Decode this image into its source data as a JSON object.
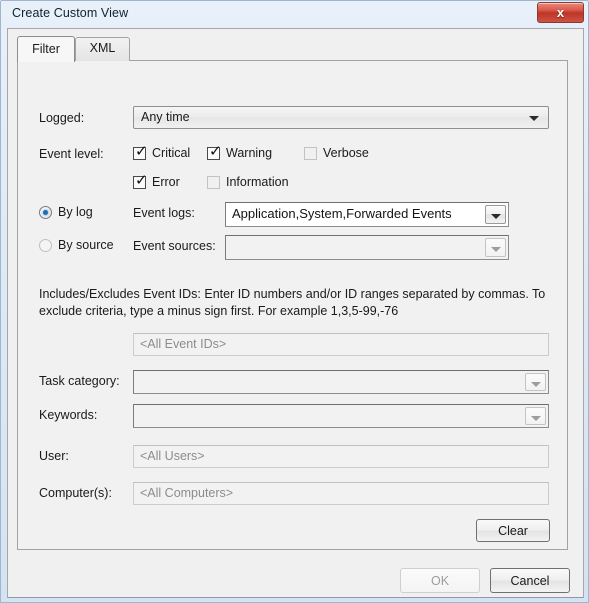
{
  "window": {
    "title": "Create Custom View",
    "close_label": "x"
  },
  "tabs": [
    {
      "label": "Filter",
      "active": true
    },
    {
      "label": "XML",
      "active": false
    }
  ],
  "filter": {
    "logged": {
      "label": "Logged:",
      "value": "Any time"
    },
    "event_level": {
      "label": "Event level:",
      "options": [
        {
          "label": "Critical",
          "checked": true
        },
        {
          "label": "Warning",
          "checked": true
        },
        {
          "label": "Verbose",
          "checked": false
        },
        {
          "label": "Error",
          "checked": true
        },
        {
          "label": "Information",
          "checked": false
        }
      ]
    },
    "source_mode": {
      "by_log_label": "By log",
      "by_source_label": "By source",
      "selected": "by_log"
    },
    "event_logs": {
      "label": "Event logs:",
      "value": "Application,System,Forwarded Events"
    },
    "event_sources": {
      "label": "Event sources:",
      "value": ""
    },
    "event_ids": {
      "help": "Includes/Excludes Event IDs: Enter ID numbers and/or ID ranges separated by commas. To exclude criteria, type a minus sign first. For example 1,3,5-99,-76",
      "placeholder": "<All Event IDs>",
      "value": ""
    },
    "task_category": {
      "label": "Task category:",
      "value": ""
    },
    "keywords": {
      "label": "Keywords:",
      "value": ""
    },
    "user": {
      "label": "User:",
      "placeholder": "<All Users>",
      "value": ""
    },
    "computers": {
      "label": "Computer(s):",
      "placeholder": "<All Computers>",
      "value": ""
    },
    "clear_button": "Clear"
  },
  "footer": {
    "ok_label": "OK",
    "cancel_label": "Cancel",
    "ok_enabled": false
  },
  "colors": {
    "close_red": "#bd3526",
    "radio_blue": "#1f6fb5",
    "dialog_bg": "#f0f0f0",
    "panel_bg": "#f1f1f1",
    "placeholder_gray": "#8c8c8c"
  }
}
